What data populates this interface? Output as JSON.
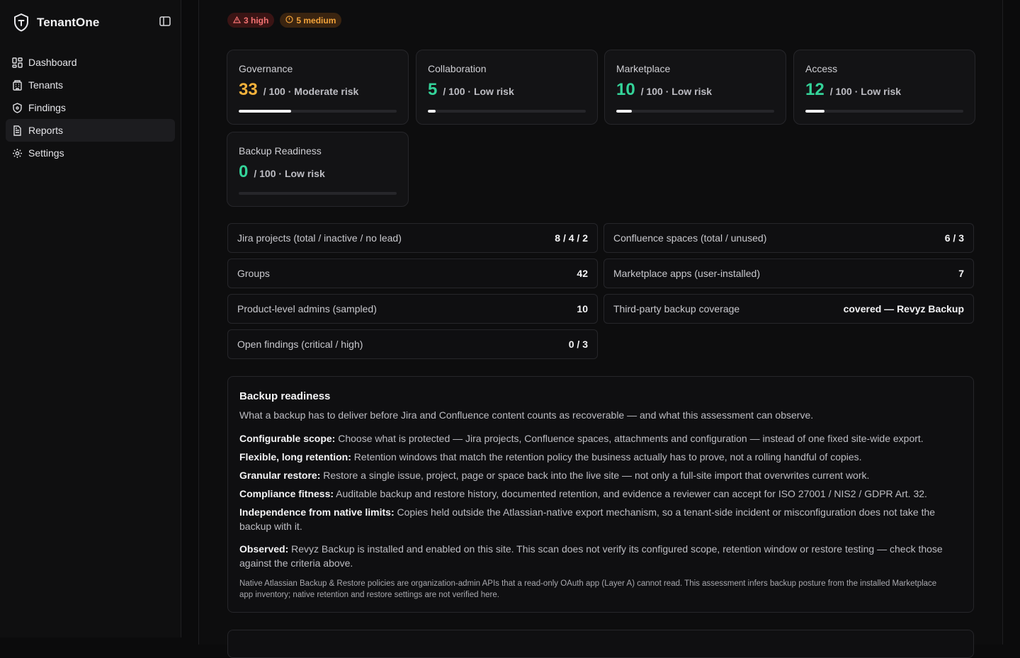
{
  "app": {
    "name": "TenantOne"
  },
  "sidebar": {
    "items": [
      {
        "label": "Dashboard",
        "icon": "dashboard-icon"
      },
      {
        "label": "Tenants",
        "icon": "building-icon"
      },
      {
        "label": "Findings",
        "icon": "shield-icon"
      },
      {
        "label": "Reports",
        "icon": "document-icon",
        "active": true
      },
      {
        "label": "Settings",
        "icon": "gear-icon"
      }
    ]
  },
  "badges": {
    "high": "3 high",
    "medium": "5 medium"
  },
  "scores": [
    {
      "label": "Governance",
      "value": "33",
      "meta": "/ 100 · Moderate risk",
      "level": 0.33,
      "color": "#f2b13b"
    },
    {
      "label": "Collaboration",
      "value": "5",
      "meta": "/ 100 · Low risk",
      "level": 0.05,
      "color": "#34d399"
    },
    {
      "label": "Marketplace",
      "value": "10",
      "meta": "/ 100 · Low risk",
      "level": 0.1,
      "color": "#34d399"
    },
    {
      "label": "Access",
      "value": "12",
      "meta": "/ 100 · Low risk",
      "level": 0.12,
      "color": "#34d399"
    },
    {
      "label": "Backup Readiness",
      "value": "0",
      "meta": "/ 100 · Low risk",
      "level": 0.0,
      "color": "#34d399"
    }
  ],
  "stats": {
    "left": [
      {
        "label": "Jira projects (total / inactive / no lead)",
        "value": "8 / 4 / 2"
      },
      {
        "label": "Groups",
        "value": "42"
      },
      {
        "label": "Product-level admins (sampled)",
        "value": "10"
      },
      {
        "label": "Open findings (critical / high)",
        "value": "0 / 3"
      }
    ],
    "right": [
      {
        "label": "Confluence spaces (total / unused)",
        "value": "6 / 3"
      },
      {
        "label": "Marketplace apps (user-installed)",
        "value": "7"
      },
      {
        "label": "Third-party backup coverage",
        "value": "covered — Revyz Backup"
      }
    ]
  },
  "backup": {
    "title": "Backup readiness",
    "description": "What a backup has to deliver before Jira and Confluence content counts as recoverable — and what this assessment can observe.",
    "criteria": [
      {
        "term": "Configurable scope:",
        "text": " Choose what is protected — Jira projects, Confluence spaces, attachments and configuration — instead of one fixed site-wide export."
      },
      {
        "term": "Flexible, long retention:",
        "text": " Retention windows that match the retention policy the business actually has to prove, not a rolling handful of copies."
      },
      {
        "term": "Granular restore:",
        "text": " Restore a single issue, project, page or space back into the live site — not only a full-site import that overwrites current work."
      },
      {
        "term": "Compliance fitness:",
        "text": " Auditable backup and restore history, documented retention, and evidence a reviewer can accept for ISO 27001 / NIS2 / GDPR Art. 32."
      },
      {
        "term": "Independence from native limits:",
        "text": " Copies held outside the Atlassian-native export mechanism, so a tenant-side incident or misconfiguration does not take the backup with it."
      },
      {
        "term": "Observed:",
        "text": " Revyz Backup is installed and enabled on this site. This scan does not verify its configured scope, retention window or restore testing — check those against the criteria above."
      }
    ],
    "note": "Native Atlassian Backup & Restore policies are organization-admin APIs that a read-only OAuth app (Layer A) cannot read. This assessment infers backup posture from the installed Marketplace app inventory; native retention and restore settings are not verified here."
  }
}
